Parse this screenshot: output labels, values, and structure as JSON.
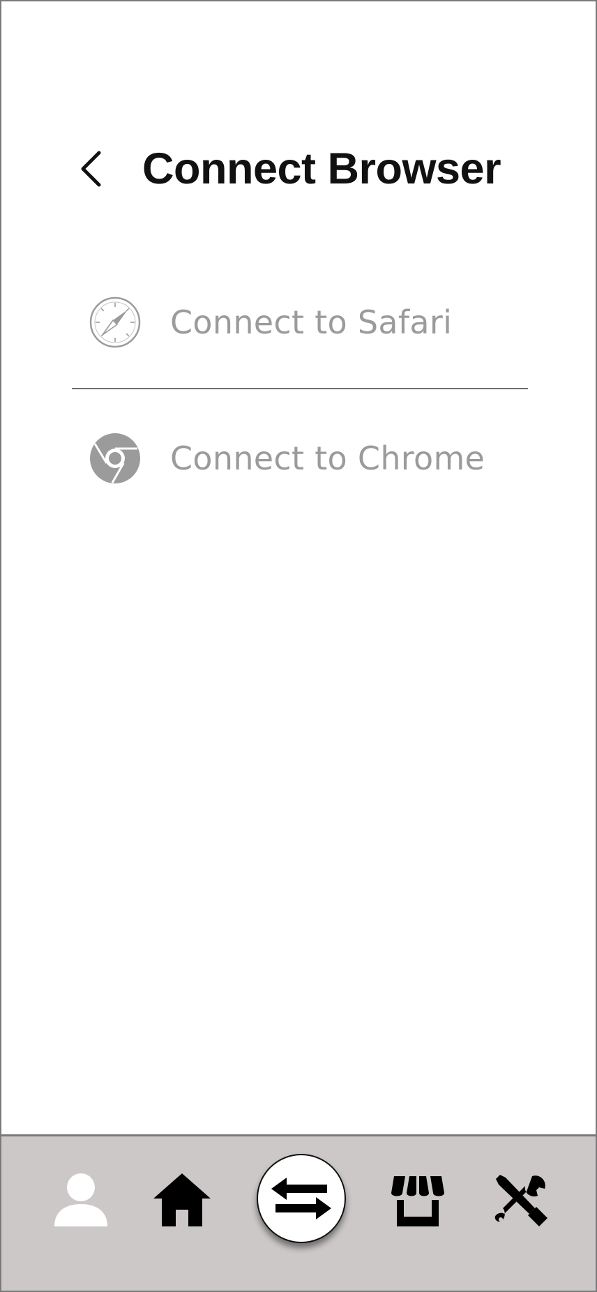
{
  "header": {
    "title": "Connect Browser",
    "back_icon": "chevron-left-icon"
  },
  "browsers": [
    {
      "label": "Connect to Safari",
      "icon": "safari-compass-icon"
    },
    {
      "label": "Connect to Chrome",
      "icon": "chrome-icon"
    }
  ],
  "bottom_nav": {
    "items": [
      {
        "icon": "user-icon",
        "color": "#ffffff"
      },
      {
        "icon": "home-icon",
        "color": "#000000"
      },
      {
        "icon": "transfer-arrows-icon",
        "color": "#000000",
        "selected": true
      },
      {
        "icon": "store-icon",
        "color": "#000000"
      },
      {
        "icon": "tools-icon",
        "color": "#000000"
      }
    ],
    "background": "#cdc8c8"
  },
  "colors": {
    "title": "#111111",
    "row_label": "#9b9b9b",
    "icon_gray": "#9b9b9b",
    "divider": "#6f6f6f"
  }
}
